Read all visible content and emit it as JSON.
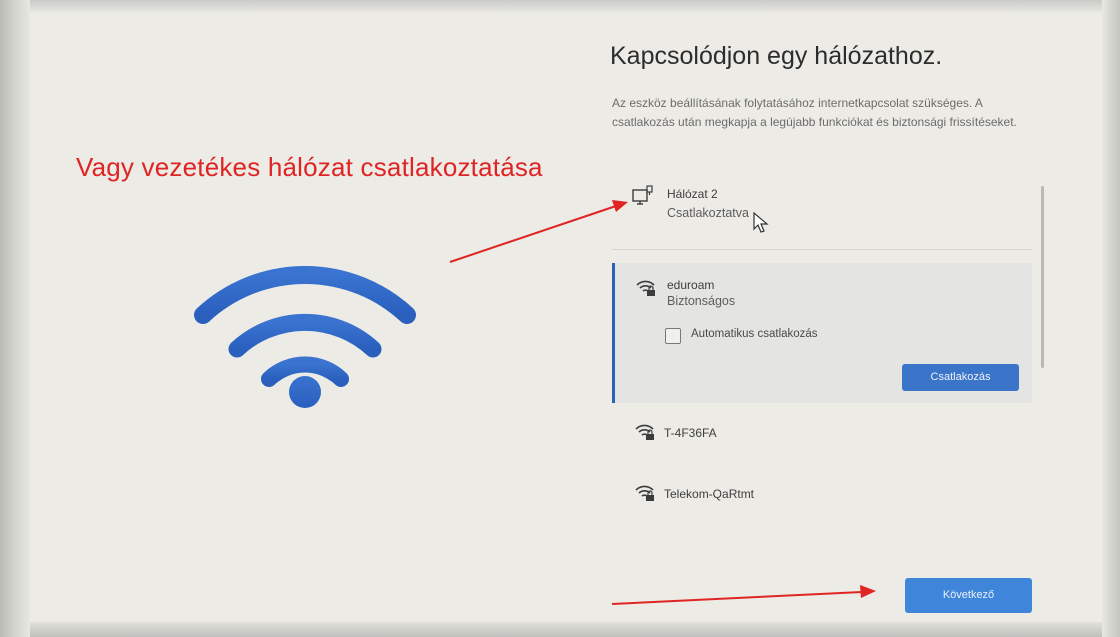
{
  "annotation": {
    "text": "Vagy vezetékes hálózat csatlakoztatása",
    "color": "#e02424"
  },
  "page": {
    "title": "Kapcsolódjon egy hálózathoz.",
    "description": "Az eszköz beállításának folytatásához internetkapcsolat szükséges. A csatlakozás után megkapja a legújabb funkciókat és biztonsági frissítéseket."
  },
  "networks": [
    {
      "name": "Hálózat 2",
      "status": "Csatlakoztatva",
      "icon": "wired-network-icon"
    },
    {
      "name": "eduroam",
      "status": "Biztonságos",
      "icon": "wifi-secured-icon",
      "auto_connect_label": "Automatikus csatlakozás",
      "auto_connect_checked": false,
      "connect_label": "Csatlakozás"
    },
    {
      "name": "T-4F36FA",
      "icon": "wifi-secured-icon"
    },
    {
      "name": "Telekom-QaRtmt",
      "icon": "wifi-secured-icon"
    }
  ],
  "footer": {
    "next_label": "Következő"
  },
  "colors": {
    "accent": "#3b75c9",
    "wifi_graphic": "#2f66c4",
    "annotation": "#e02424"
  }
}
